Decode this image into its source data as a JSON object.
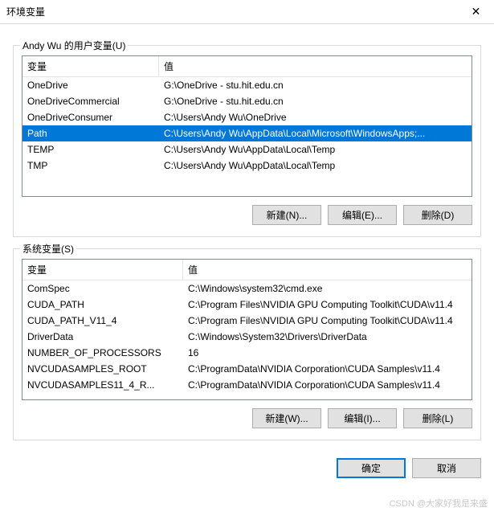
{
  "titlebar": {
    "title": "环境变量",
    "close_label": "✕"
  },
  "user_section": {
    "group_label": "Andy Wu 的用户变量(U)",
    "columns": {
      "name": "变量",
      "value": "值"
    },
    "rows": [
      {
        "name": "OneDrive",
        "value": "G:\\OneDrive - stu.hit.edu.cn",
        "selected": false
      },
      {
        "name": "OneDriveCommercial",
        "value": "G:\\OneDrive - stu.hit.edu.cn",
        "selected": false
      },
      {
        "name": "OneDriveConsumer",
        "value": "C:\\Users\\Andy Wu\\OneDrive",
        "selected": false
      },
      {
        "name": "Path",
        "value": "C:\\Users\\Andy Wu\\AppData\\Local\\Microsoft\\WindowsApps;...",
        "selected": true
      },
      {
        "name": "TEMP",
        "value": "C:\\Users\\Andy Wu\\AppData\\Local\\Temp",
        "selected": false
      },
      {
        "name": "TMP",
        "value": "C:\\Users\\Andy Wu\\AppData\\Local\\Temp",
        "selected": false
      }
    ],
    "buttons": {
      "new": "新建(N)...",
      "edit": "编辑(E)...",
      "delete": "删除(D)"
    }
  },
  "system_section": {
    "group_label": "系统变量(S)",
    "columns": {
      "name": "变量",
      "value": "值"
    },
    "rows": [
      {
        "name": "ComSpec",
        "value": "C:\\Windows\\system32\\cmd.exe"
      },
      {
        "name": "CUDA_PATH",
        "value": "C:\\Program Files\\NVIDIA GPU Computing Toolkit\\CUDA\\v11.4"
      },
      {
        "name": "CUDA_PATH_V11_4",
        "value": "C:\\Program Files\\NVIDIA GPU Computing Toolkit\\CUDA\\v11.4"
      },
      {
        "name": "DriverData",
        "value": "C:\\Windows\\System32\\Drivers\\DriverData"
      },
      {
        "name": "NUMBER_OF_PROCESSORS",
        "value": "16"
      },
      {
        "name": "NVCUDASAMPLES_ROOT",
        "value": "C:\\ProgramData\\NVIDIA Corporation\\CUDA Samples\\v11.4"
      },
      {
        "name": "NVCUDASAMPLES11_4_R...",
        "value": "C:\\ProgramData\\NVIDIA Corporation\\CUDA Samples\\v11.4"
      }
    ],
    "buttons": {
      "new": "新建(W)...",
      "edit": "编辑(I)...",
      "delete": "删除(L)"
    }
  },
  "dialog_buttons": {
    "ok": "确定",
    "cancel": "取消"
  },
  "watermark": "CSDN @大家好我是来盛"
}
